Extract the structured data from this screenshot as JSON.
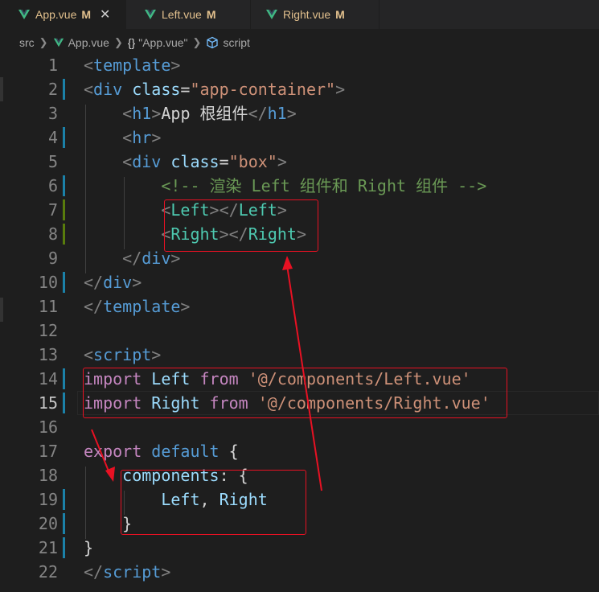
{
  "tabs": [
    {
      "label": "App.vue",
      "badge": "M",
      "close": "✕",
      "active": true
    },
    {
      "label": "Left.vue",
      "badge": "M",
      "active": false
    },
    {
      "label": "Right.vue",
      "badge": "M",
      "active": false
    }
  ],
  "breadcrumb": {
    "root": "src",
    "file": "App.vue",
    "braces": "{}",
    "section": "\"App.vue\"",
    "symbol": "script"
  },
  "colors": {
    "vue_icon": "#41b883",
    "modified_badge": "#e2c08d",
    "annotation_red": "#e81123"
  },
  "line_numbers": [
    "1",
    "2",
    "3",
    "4",
    "5",
    "6",
    "7",
    "8",
    "9",
    "10",
    "11",
    "12",
    "13",
    "14",
    "15",
    "16",
    "17",
    "18",
    "19",
    "20",
    "21",
    "22"
  ],
  "code": {
    "l1": {
      "open": "<",
      "tag": "template",
      "close": ">"
    },
    "l2": {
      "open": "<",
      "tag": "div",
      "attr": " class",
      "eq": "=",
      "val": "\"app-container\"",
      "close": ">"
    },
    "l3": {
      "indent": "    ",
      "open": "<",
      "tag": "h1",
      "close": ">",
      "text": "App 根组件",
      "open2": "</",
      "tag2": "h1",
      "close2": ">"
    },
    "l4": {
      "indent": "    ",
      "open": "<",
      "tag": "hr",
      "close": ">"
    },
    "l5": {
      "indent": "    ",
      "open": "<",
      "tag": "div",
      "attr": " class",
      "eq": "=",
      "val": "\"box\"",
      "close": ">"
    },
    "l6": {
      "indent": "        ",
      "comment": "<!-- 渲染 Left 组件和 Right 组件 -->"
    },
    "l7": {
      "indent": "        ",
      "open": "<",
      "tag": "Left",
      "close": ">",
      "open2": "</",
      "tag2": "Left",
      "close2": ">"
    },
    "l8": {
      "indent": "        ",
      "open": "<",
      "tag": "Right",
      "close": ">",
      "open2": "</",
      "tag2": "Right",
      "close2": ">"
    },
    "l9": {
      "indent": "    ",
      "open": "</",
      "tag": "div",
      "close": ">"
    },
    "l10": {
      "open": "</",
      "tag": "div",
      "close": ">"
    },
    "l11": {
      "open": "</",
      "tag": "template",
      "close": ">"
    },
    "l13": {
      "open": "<",
      "tag": "script",
      "close": ">"
    },
    "l14": {
      "kw": "import",
      "name": " Left ",
      "kw2": "from",
      "str": " '@/components/Left.vue'"
    },
    "l15": {
      "kw": "import",
      "name": " Right ",
      "kw2": "from",
      "str": " '@/components/Right.vue'"
    },
    "l17": {
      "kw": "export",
      "kw2": " default",
      "rest": " {"
    },
    "l18": {
      "indent": "    ",
      "prop": "components",
      "rest": ": {"
    },
    "l19": {
      "indent": "        ",
      "name1": "Left",
      "comma": ", ",
      "name2": "Right"
    },
    "l20": {
      "indent": "    ",
      "rest": "}"
    },
    "l21": {
      "rest": "}"
    },
    "l22": {
      "open": "</",
      "tag": "script",
      "close": ">"
    }
  }
}
